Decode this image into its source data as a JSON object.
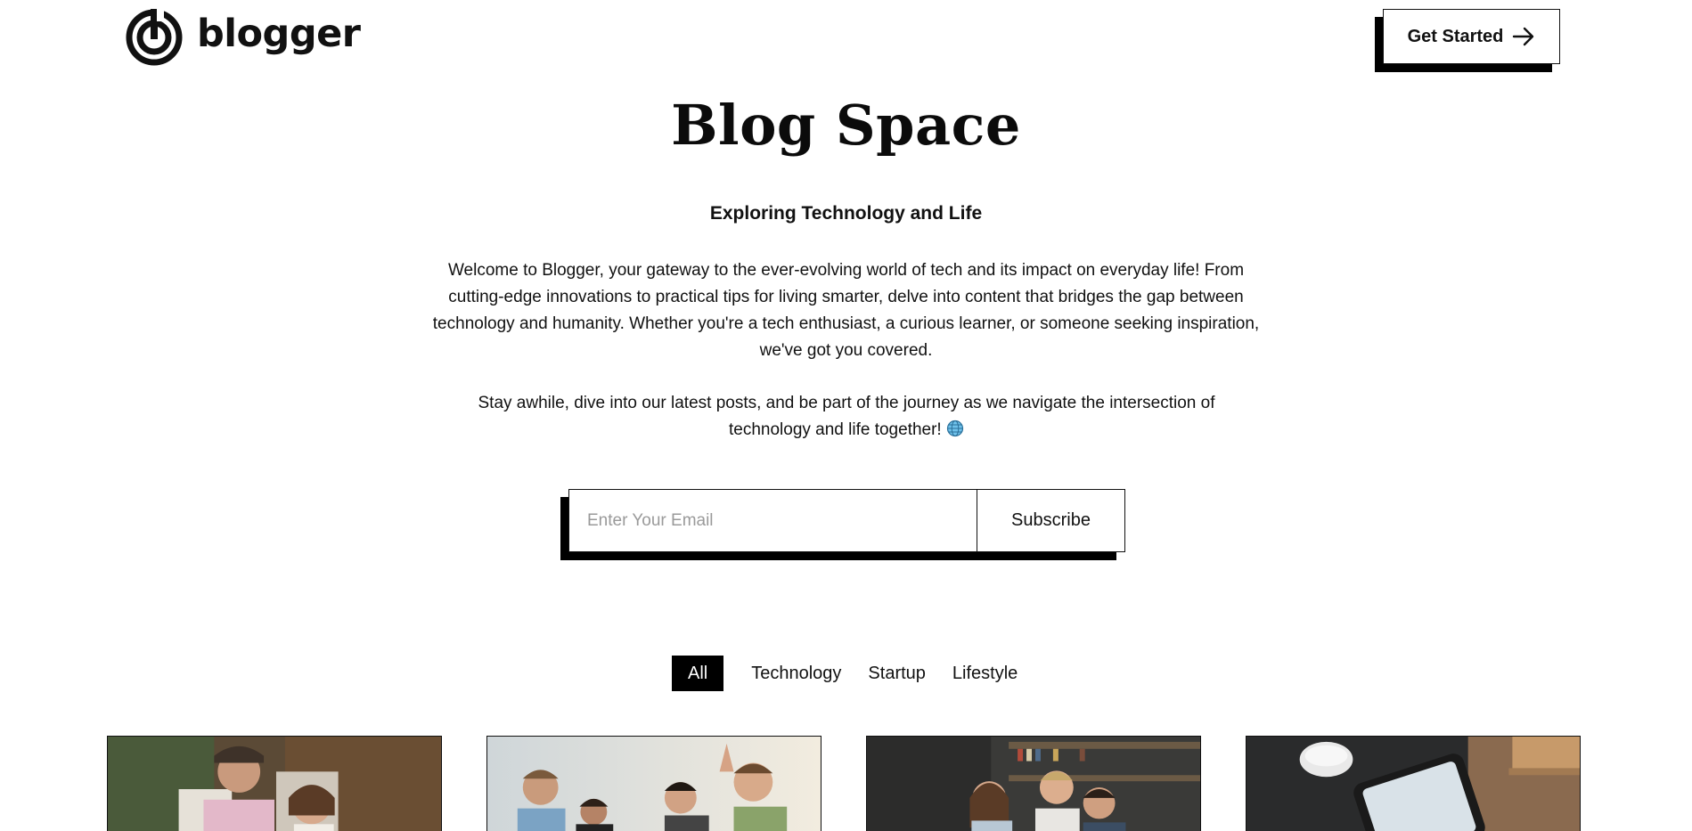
{
  "header": {
    "logo_text": "blogger",
    "cta_label": "Get Started"
  },
  "hero": {
    "title": "Blog Space",
    "subtitle": "Exploring Technology and Life",
    "paragraph1": "Welcome to Blogger, your gateway to the ever-evolving world of tech and its impact on everyday life! From cutting-edge innovations to practical tips for living smarter, delve into content that bridges the gap between technology and humanity. Whether you're a tech enthusiast, a curious learner, or someone seeking inspiration, we've got you covered.",
    "paragraph2": "Stay awhile, dive into our latest posts, and be part of the journey as we navigate the intersection of technology and life together!"
  },
  "subscribe": {
    "email_placeholder": "Enter Your Email",
    "button_label": "Subscribe"
  },
  "filters": [
    {
      "label": "All",
      "active": true
    },
    {
      "label": "Technology",
      "active": false
    },
    {
      "label": "Startup",
      "active": false
    },
    {
      "label": "Lifestyle",
      "active": false
    }
  ],
  "cards": [
    {
      "image": "man-and-woman-outdoors-photo"
    },
    {
      "image": "group-of-friends-sunny-photo"
    },
    {
      "image": "people-working-at-laptops-photo"
    },
    {
      "image": "tablet-and-mouse-on-desk-photo"
    }
  ],
  "icons": {
    "logo": "blogger-logo-icon",
    "cta_arrow": "arrow-right-icon",
    "globe": "globe-emoji-icon"
  },
  "colors": {
    "background": "#ffffff",
    "text": "#111111",
    "accent": "#000000",
    "placeholder": "#9a9a9a"
  }
}
